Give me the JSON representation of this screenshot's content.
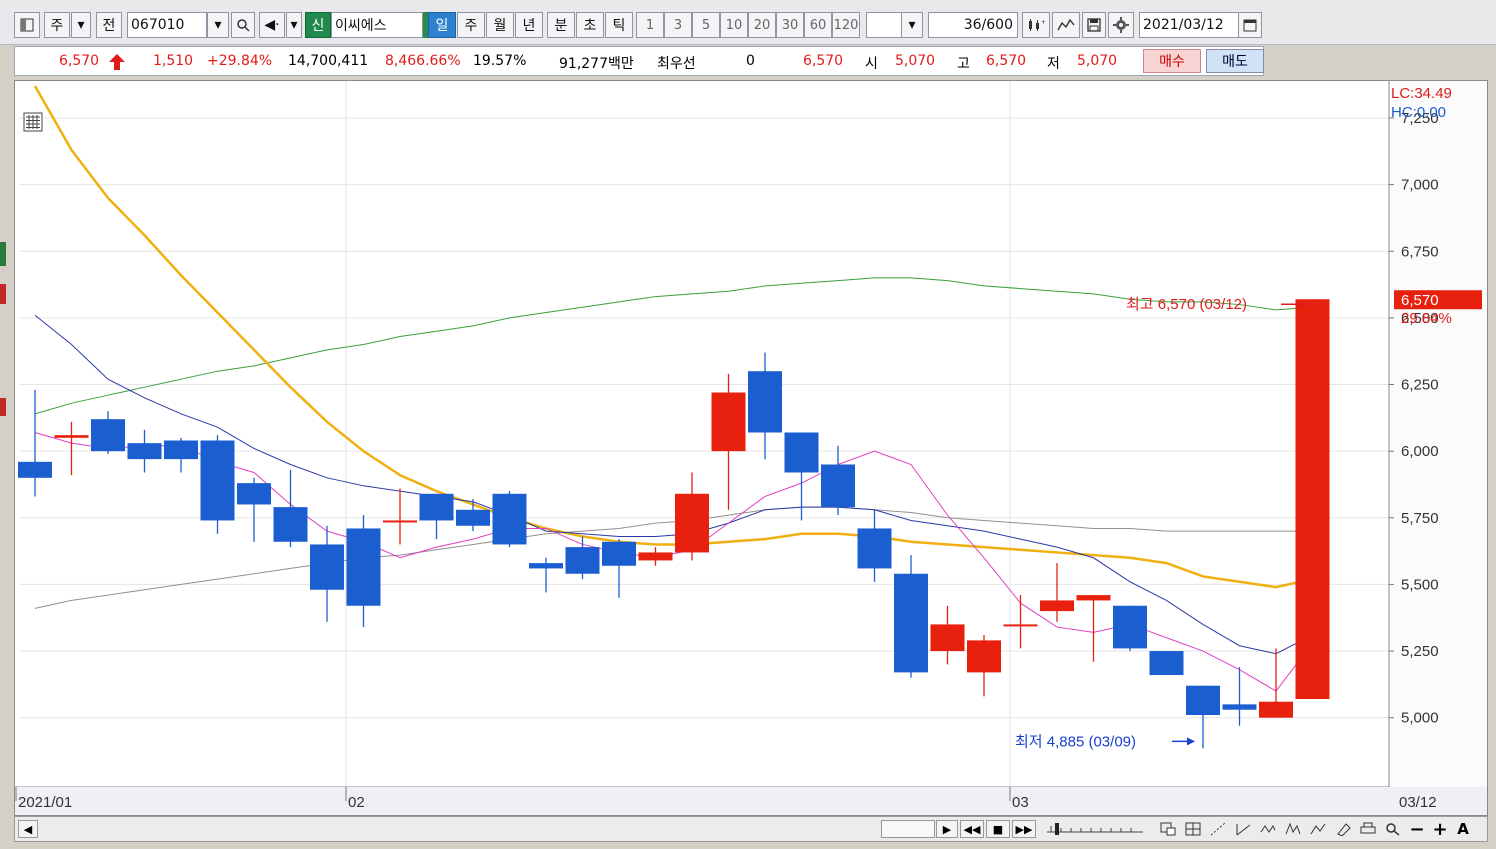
{
  "toolbar": {
    "market_label": "주",
    "prev_label": "전",
    "code": "067010",
    "search_icon": "search-icon",
    "credit_badge": "신",
    "stock_name": "이씨에스",
    "periods": [
      "일",
      "주",
      "월",
      "년",
      "분",
      "초",
      "틱"
    ],
    "active_period": "일",
    "intervals": [
      "1",
      "3",
      "5",
      "10",
      "20",
      "30",
      "60",
      "120"
    ],
    "count_value": "36",
    "count_total": "/600",
    "date": "2021/03/12"
  },
  "info": {
    "price": "6,570",
    "change": "1,510",
    "change_pct": "+29.84%",
    "volume": "14,700,411",
    "volume_ratio": "8,466.66%",
    "turnover": "19.57%",
    "amount": "91,277백만",
    "best_label": "최우선",
    "best_value": "0",
    "best_price": "6,570",
    "open_label": "시",
    "open": "5,070",
    "high_label": "고",
    "high": "6,570",
    "low_label": "저",
    "low": "5,070",
    "buy_label": "매수",
    "sell_label": "매도"
  },
  "colors": {
    "up": "#e8200e",
    "down": "#1b5ed0",
    "ma5": "#e040c0",
    "ma10": "#2a3aa8",
    "ma20": "#f0b010",
    "ma60": "#3aa03a",
    "ma120": "#909090"
  },
  "chart_data": {
    "type": "candlestick",
    "y_axis_ticks": [
      "7,000",
      "6,750",
      "6,500",
      "6,250",
      "6,000",
      "5,750",
      "5,500",
      "5,250",
      "5,000"
    ],
    "y_axis_partial_tick": "7,250",
    "ylim": [
      4800,
      7370
    ],
    "x_labels": [
      "2021/01",
      "02",
      "03",
      "03/12"
    ],
    "lc_label": "LC:34.49",
    "hc_label": "HC:0.00",
    "last_price_tag": "6,570",
    "last_pct_tag": "29.84%",
    "high_annotation": "최고 6,570 (03/12)",
    "low_annotation": "최저 4,885 (03/09)",
    "candles": [
      {
        "o": 5960,
        "h": 6230,
        "l": 5830,
        "c": 5900
      },
      {
        "o": 6050,
        "h": 6110,
        "l": 5910,
        "c": 6060
      },
      {
        "o": 6120,
        "h": 6150,
        "l": 5990,
        "c": 6000
      },
      {
        "o": 6030,
        "h": 6080,
        "l": 5920,
        "c": 5970
      },
      {
        "o": 6040,
        "h": 6050,
        "l": 5920,
        "c": 5970
      },
      {
        "o": 6040,
        "h": 6060,
        "l": 5690,
        "c": 5740
      },
      {
        "o": 5880,
        "h": 5900,
        "l": 5660,
        "c": 5800
      },
      {
        "o": 5790,
        "h": 5930,
        "l": 5640,
        "c": 5660
      },
      {
        "o": 5650,
        "h": 5720,
        "l": 5360,
        "c": 5480
      },
      {
        "o": 5710,
        "h": 5760,
        "l": 5340,
        "c": 5420
      },
      {
        "o": 5740,
        "h": 5860,
        "l": 5650,
        "c": 5740
      },
      {
        "o": 5840,
        "h": 5840,
        "l": 5670,
        "c": 5740
      },
      {
        "o": 5780,
        "h": 5820,
        "l": 5700,
        "c": 5720
      },
      {
        "o": 5840,
        "h": 5850,
        "l": 5640,
        "c": 5650
      },
      {
        "o": 5580,
        "h": 5600,
        "l": 5470,
        "c": 5560
      },
      {
        "o": 5640,
        "h": 5680,
        "l": 5520,
        "c": 5540
      },
      {
        "o": 5660,
        "h": 5670,
        "l": 5450,
        "c": 5570
      },
      {
        "o": 5590,
        "h": 5640,
        "l": 5570,
        "c": 5620
      },
      {
        "o": 5620,
        "h": 5920,
        "l": 5590,
        "c": 5840
      },
      {
        "o": 6000,
        "h": 6290,
        "l": 5780,
        "c": 6220
      },
      {
        "o": 6300,
        "h": 6370,
        "l": 5970,
        "c": 6070
      },
      {
        "o": 6070,
        "h": 6060,
        "l": 5740,
        "c": 5920
      },
      {
        "o": 5950,
        "h": 6020,
        "l": 5760,
        "c": 5790
      },
      {
        "o": 5710,
        "h": 5780,
        "l": 5510,
        "c": 5560
      },
      {
        "o": 5540,
        "h": 5610,
        "l": 5150,
        "c": 5170
      },
      {
        "o": 5250,
        "h": 5420,
        "l": 5200,
        "c": 5350
      },
      {
        "o": 5170,
        "h": 5310,
        "l": 5080,
        "c": 5290
      },
      {
        "o": 5350,
        "h": 5460,
        "l": 5260,
        "c": 5350
      },
      {
        "o": 5400,
        "h": 5580,
        "l": 5360,
        "c": 5440
      },
      {
        "o": 5440,
        "h": 5450,
        "l": 5210,
        "c": 5460
      },
      {
        "o": 5420,
        "h": 5420,
        "l": 5250,
        "c": 5260
      },
      {
        "o": 5250,
        "h": 5250,
        "l": 5160,
        "c": 5160
      },
      {
        "o": 5120,
        "h": 5120,
        "l": 4885,
        "c": 5010
      },
      {
        "o": 5050,
        "h": 5190,
        "l": 4970,
        "c": 5030
      },
      {
        "o": 5000,
        "h": 5260,
        "l": 5000,
        "c": 5060
      },
      {
        "o": 5070,
        "h": 6570,
        "l": 5070,
        "c": 6570
      }
    ],
    "ma5": [
      6070,
      6030,
      6010,
      6020,
      6020,
      5960,
      5920,
      5800,
      5700,
      5660,
      5600,
      5640,
      5670,
      5710,
      5710,
      5650,
      5620,
      5600,
      5630,
      5730,
      5830,
      5880,
      5950,
      6000,
      5950,
      5760,
      5600,
      5430,
      5340,
      5320,
      5350,
      5300,
      5250,
      5180,
      5100,
      5280
    ],
    "ma10": [
      6510,
      6400,
      6270,
      6200,
      6140,
      6090,
      6010,
      5950,
      5900,
      5870,
      5850,
      5830,
      5810,
      5760,
      5700,
      5690,
      5680,
      5680,
      5690,
      5730,
      5780,
      5790,
      5790,
      5780,
      5740,
      5720,
      5700,
      5670,
      5640,
      5600,
      5510,
      5440,
      5350,
      5270,
      5240,
      5310
    ],
    "ma20": [
      7370,
      7130,
      6950,
      6810,
      6660,
      6520,
      6380,
      6240,
      6110,
      6000,
      5910,
      5850,
      5800,
      5750,
      5710,
      5680,
      5660,
      5650,
      5650,
      5660,
      5670,
      5690,
      5690,
      5680,
      5660,
      5650,
      5640,
      5630,
      5620,
      5610,
      5600,
      5580,
      5530,
      5510,
      5490,
      5520
    ],
    "ma60": [
      6140,
      6180,
      6210,
      6240,
      6270,
      6300,
      6320,
      6350,
      6380,
      6400,
      6430,
      6450,
      6470,
      6500,
      6520,
      6540,
      6560,
      6580,
      6590,
      6600,
      6620,
      6630,
      6640,
      6650,
      6650,
      6640,
      6620,
      6610,
      6600,
      6590,
      6570,
      6560,
      6560,
      6550,
      6530,
      6540
    ],
    "ma120": [
      5410,
      5440,
      5460,
      5480,
      5500,
      5520,
      5540,
      5560,
      5580,
      5600,
      5610,
      5630,
      5650,
      5670,
      5690,
      5700,
      5710,
      5730,
      5740,
      5760,
      5780,
      5790,
      5790,
      5780,
      5770,
      5750,
      5740,
      5730,
      5720,
      5710,
      5710,
      5700,
      5700,
      5700,
      5700,
      5700
    ]
  }
}
